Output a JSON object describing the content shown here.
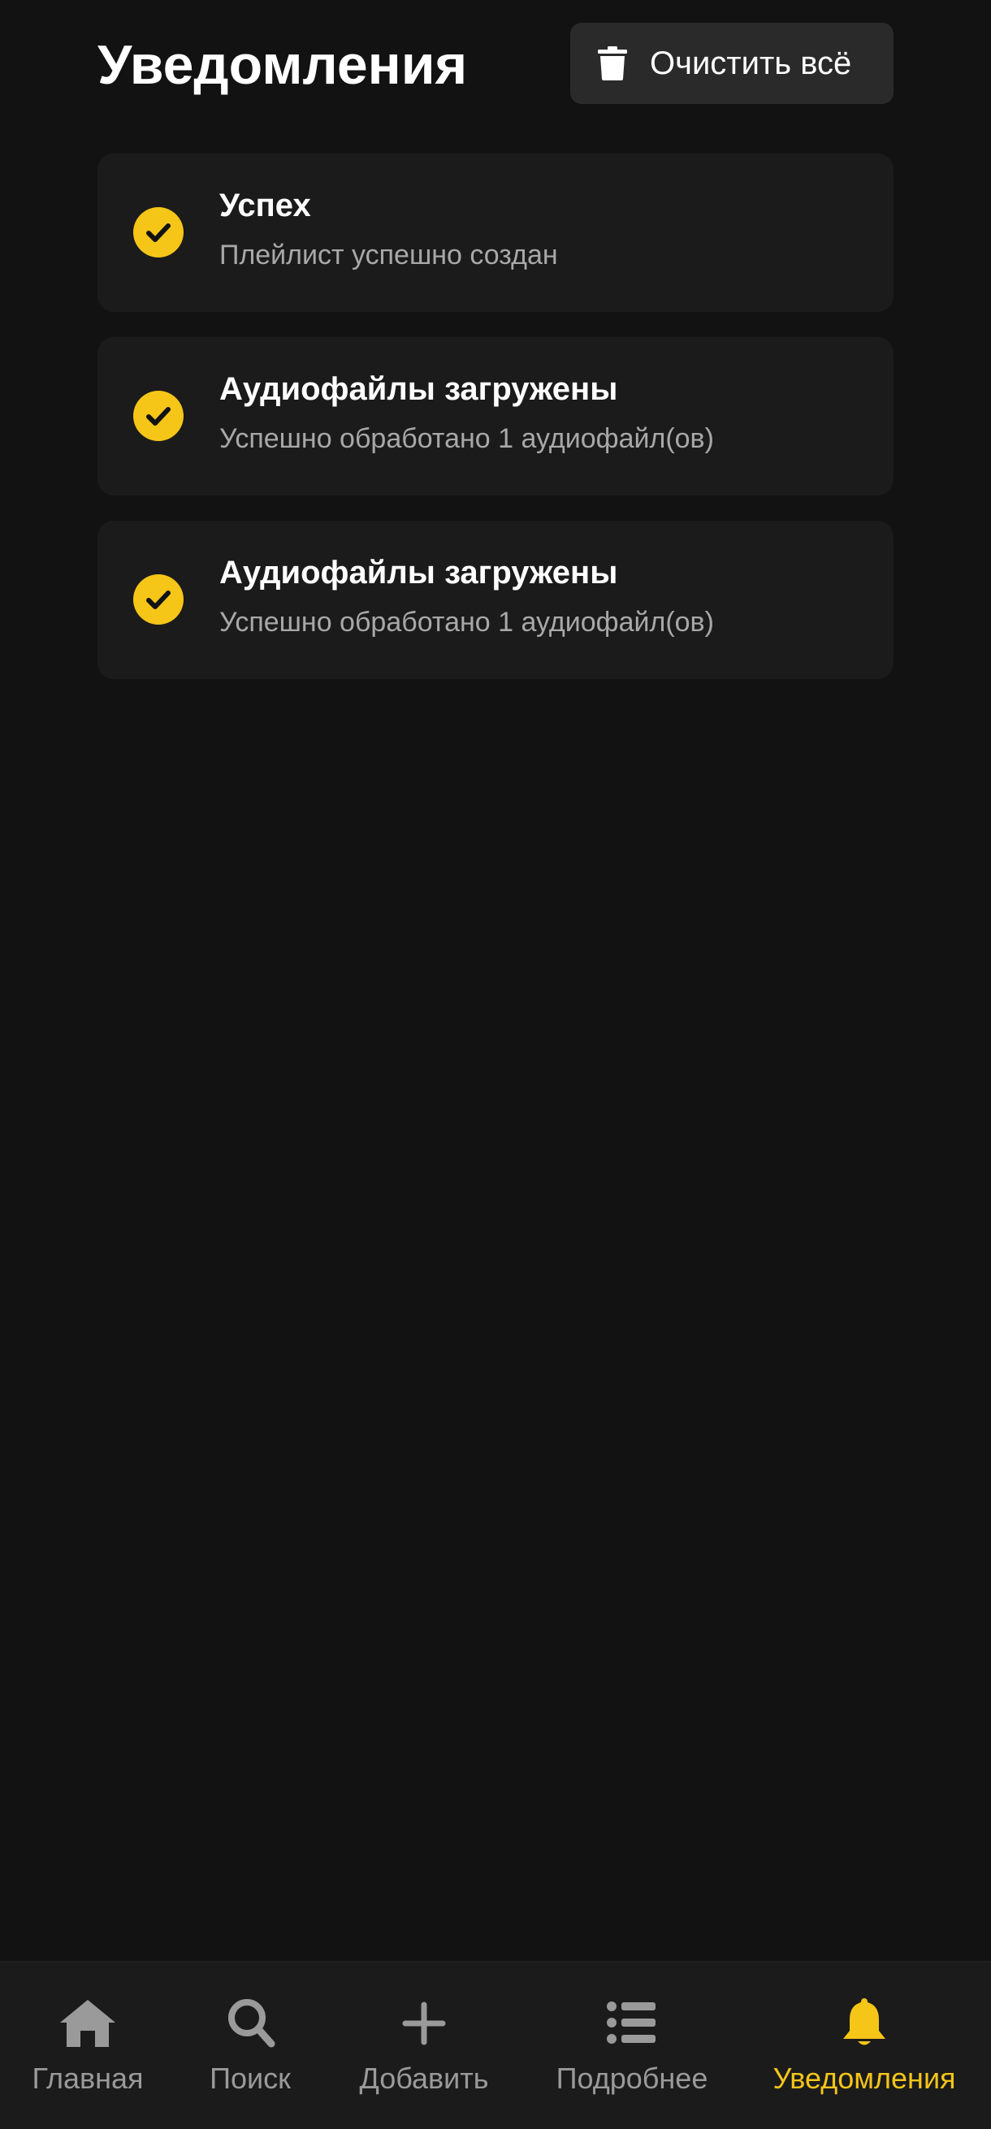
{
  "header": {
    "title": "Уведомления",
    "clear_label": "Очистить всё"
  },
  "notifications": [
    {
      "title": "Успех",
      "message": "Плейлист успешно создан",
      "icon": "check-circle-icon"
    },
    {
      "title": "Аудиофайлы загружены",
      "message": "Успешно обработано 1 аудиофайл(ов)",
      "icon": "check-circle-icon"
    },
    {
      "title": "Аудиофайлы загружены",
      "message": "Успешно обработано 1 аудиофайл(ов)",
      "icon": "check-circle-icon"
    }
  ],
  "bottom_nav": {
    "items": [
      {
        "label": "Главная",
        "icon": "home-icon",
        "active": false
      },
      {
        "label": "Поиск",
        "icon": "search-icon",
        "active": false
      },
      {
        "label": "Добавить",
        "icon": "plus-icon",
        "active": false
      },
      {
        "label": "Подробнее",
        "icon": "list-icon",
        "active": false
      },
      {
        "label": "Уведомления",
        "icon": "bell-icon",
        "active": true
      }
    ]
  },
  "colors": {
    "background": "#121212",
    "card": "#1b1b1b",
    "accent": "#f5c518",
    "inactive": "#9a9a9a"
  }
}
